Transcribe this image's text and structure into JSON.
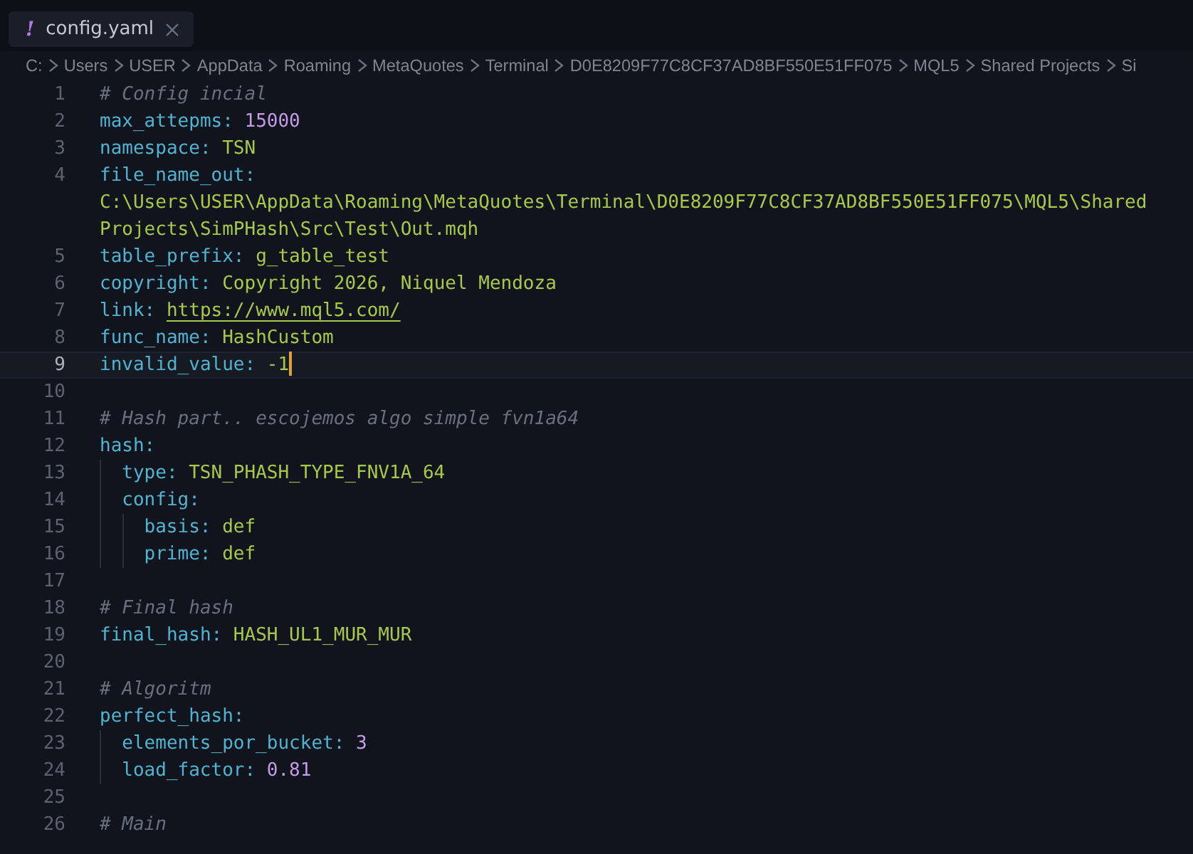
{
  "tab": {
    "icon_text": "!",
    "label": "config.yaml",
    "selected": true
  },
  "breadcrumbs": [
    "C:",
    "Users",
    "USER",
    "AppData",
    "Roaming",
    "MetaQuotes",
    "Terminal",
    "D0E8209F77C8CF37AD8BF550E51FF075",
    "MQL5",
    "Shared Projects",
    "Si"
  ],
  "lines": [
    {
      "number": "1",
      "kind": "comment",
      "text": "# Config incial",
      "active": false
    },
    {
      "number": "2",
      "kind": "number",
      "key": "max_attepms:",
      "value": "15000",
      "active": false
    },
    {
      "number": "3",
      "kind": "string",
      "key": "namespace:",
      "value": "TSN",
      "active": false
    },
    {
      "number": "4",
      "kind": "string",
      "key": "file_name_out:",
      "value": "C:\\Users\\USER\\AppData\\Roaming\\MetaQuotes\\Terminal\\D0E8209F77C8CF37AD8BF550E51FF075\\MQL5\\Shared Projects\\SimPHash\\Src\\Test\\Out.mqh",
      "active": false
    },
    {
      "number": "5",
      "kind": "string",
      "key": "table_prefix:",
      "value": "g_table_test",
      "active": false
    },
    {
      "number": "6",
      "kind": "string",
      "key": "copyright:",
      "value": "Copyright 2026, Niquel Mendoza",
      "active": false
    },
    {
      "number": "7",
      "kind": "link",
      "key": "link:",
      "value": "https://www.mql5.com/",
      "active": false
    },
    {
      "number": "8",
      "kind": "string",
      "key": "func_name:",
      "value": "HashCustom",
      "active": false
    },
    {
      "number": "9",
      "kind": "string",
      "key": "invalid_value:",
      "value": "-1",
      "active": true
    },
    {
      "number": "10",
      "kind": "blank",
      "active": false
    },
    {
      "number": "11",
      "kind": "comment",
      "text": "# Hash part.. escojemos algo simple fvn1a64",
      "active": false
    },
    {
      "number": "12",
      "kind": "map",
      "key": "hash:",
      "active": false,
      "children": [
        {
          "number": "13",
          "kind": "string",
          "key": "type:",
          "value": "TSN_PHASH_TYPE_FNV1A_64",
          "active": false
        },
        {
          "number": "14",
          "kind": "map",
          "key": "config:",
          "active": false,
          "children": [
            {
              "number": "15",
              "kind": "string",
              "key": "basis:",
              "value": "def",
              "active": false
            },
            {
              "number": "16",
              "kind": "string",
              "key": "prime:",
              "value": "def",
              "active": false
            }
          ]
        }
      ]
    },
    {
      "number": "17",
      "kind": "blank",
      "active": false
    },
    {
      "number": "18",
      "kind": "comment",
      "text": "# Final hash",
      "active": false
    },
    {
      "number": "19",
      "kind": "string",
      "key": "final_hash:",
      "value": "HASH_UL1_MUR_MUR",
      "active": false
    },
    {
      "number": "20",
      "kind": "blank",
      "active": false
    },
    {
      "number": "21",
      "kind": "comment",
      "text": "# Algoritm",
      "active": false
    },
    {
      "number": "22",
      "kind": "map",
      "key": "perfect_hash:",
      "active": false,
      "children": [
        {
          "number": "23",
          "kind": "number",
          "key": "elements_por_bucket:",
          "value": "3",
          "active": false
        },
        {
          "number": "24",
          "kind": "number",
          "key": "load_factor:",
          "value": "0.81",
          "active": false
        }
      ]
    },
    {
      "number": "25",
      "kind": "blank",
      "active": false
    },
    {
      "number": "26",
      "kind": "comment",
      "text": "# Main",
      "active": false
    }
  ]
}
